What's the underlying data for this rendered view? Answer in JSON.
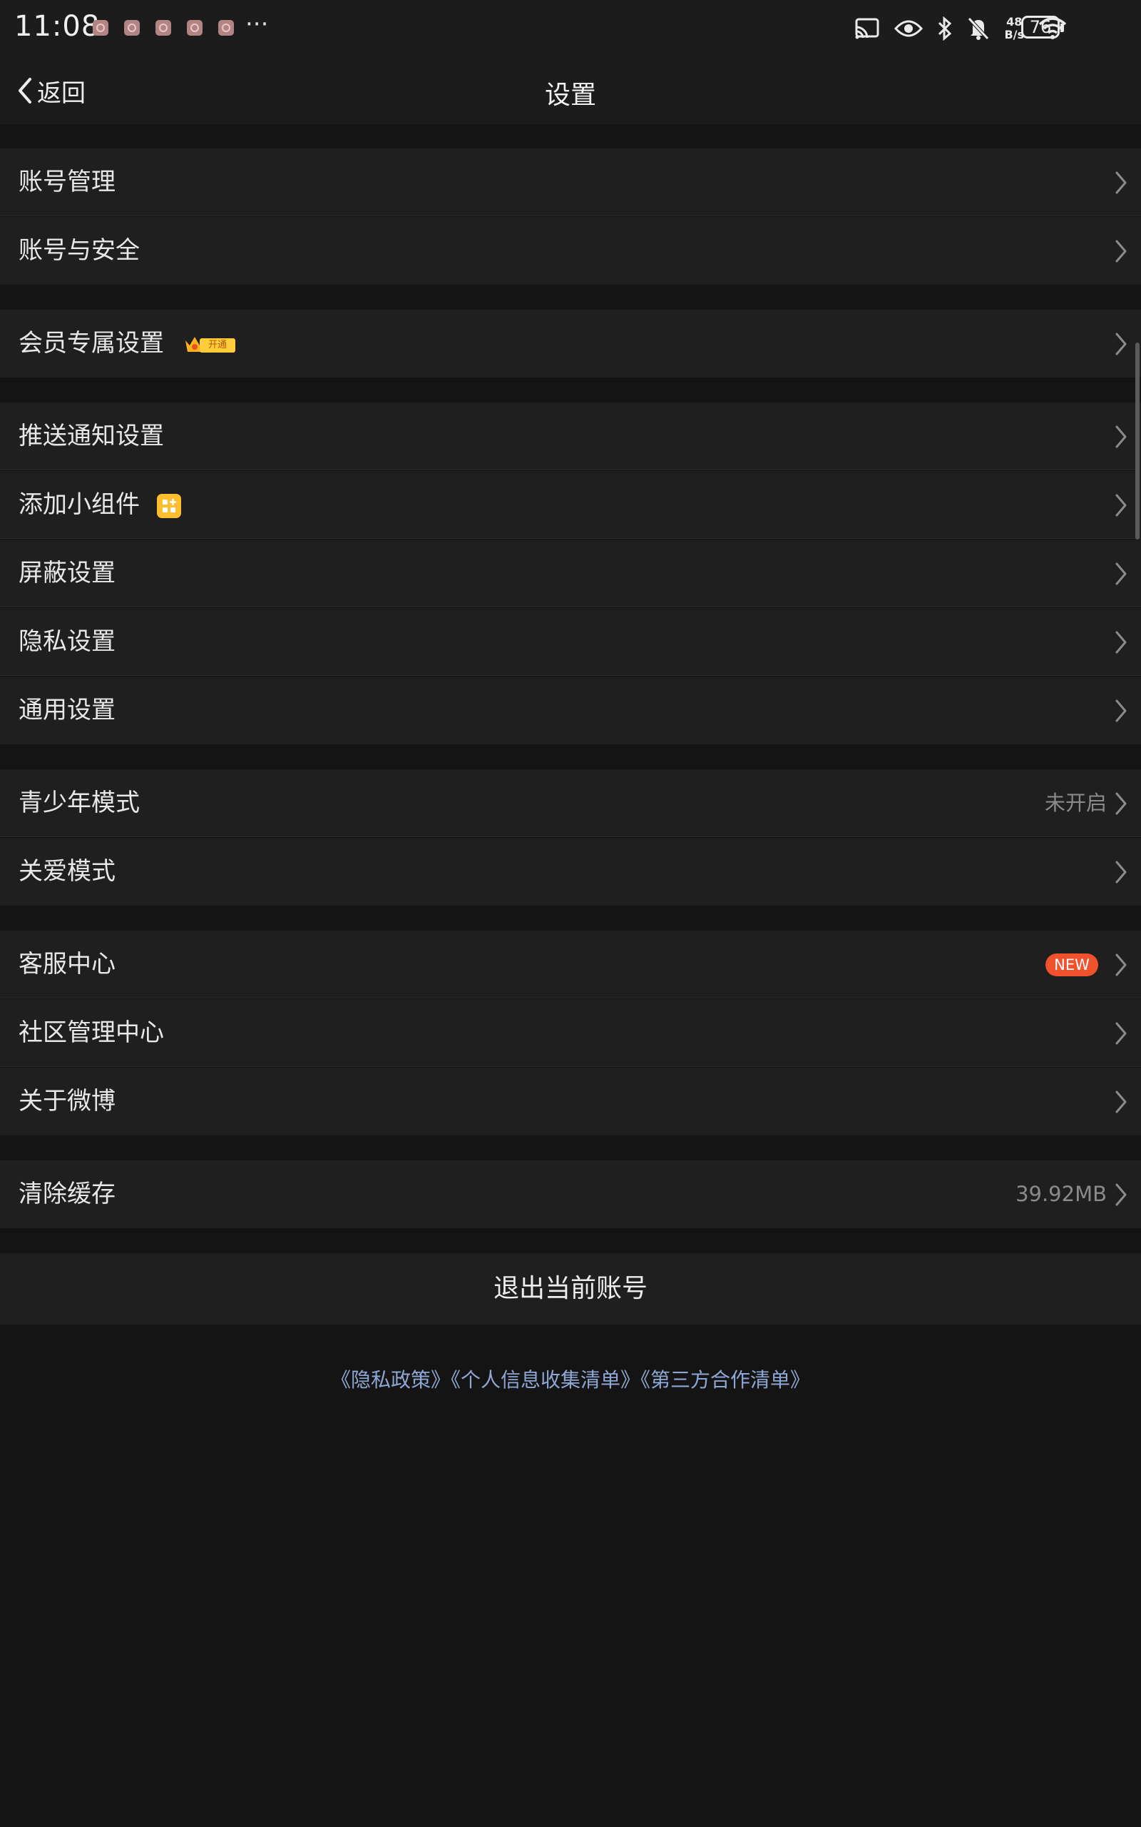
{
  "status_bar": {
    "time": "11:08",
    "more": "···",
    "net_speed_top": "48",
    "net_speed_bottom": "B/s",
    "battery": "76",
    "icons": [
      "cast-icon",
      "eye-icon",
      "bluetooth-icon",
      "mute-icon",
      "wifi-icon",
      "battery-icon"
    ]
  },
  "nav": {
    "back_label": "返回",
    "title": "设置"
  },
  "settings": {
    "account_management": "账号管理",
    "account_security": "账号与安全",
    "vip_settings": "会员专属设置",
    "vip_badge": "开通",
    "push_notifications": "推送通知设置",
    "add_widget": "添加小组件",
    "block_settings": "屏蔽设置",
    "privacy_settings": "隐私设置",
    "general_settings": "通用设置",
    "teen_mode": "青少年模式",
    "teen_mode_value": "未开启",
    "care_mode": "关爱模式",
    "customer_service": "客服中心",
    "customer_service_badge": "NEW",
    "community_center": "社区管理中心",
    "about_weibo": "关于微博",
    "clear_cache": "清除缓存",
    "clear_cache_value": "39.92MB"
  },
  "logout_label": "退出当前账号",
  "footer": {
    "privacy_policy": "《隐私政策》",
    "personal_info_list": "《个人信息收集清单》",
    "third_party_list": "《第三方合作清单》"
  },
  "colors": {
    "background": "#141414",
    "row_background": "#1f1f1f",
    "new_badge": "#f0522e",
    "link": "#8fa7d4",
    "vip_gold": "#ffcd3b"
  }
}
